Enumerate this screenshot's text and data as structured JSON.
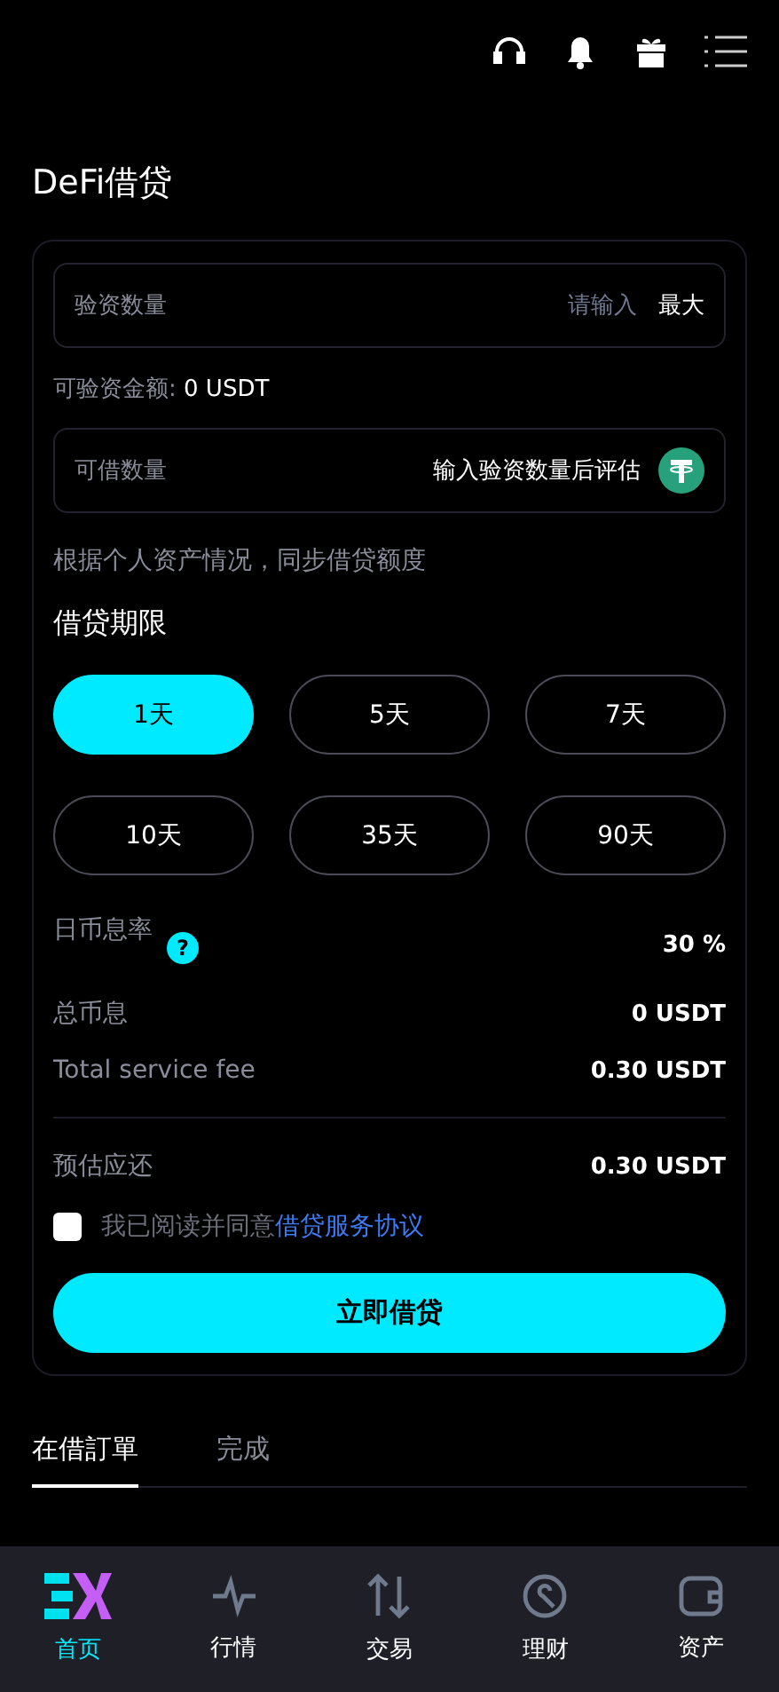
{
  "title": "DeFi借贷",
  "collateral_field": {
    "label": "验资数量",
    "placeholder": "请输入",
    "max_button": "最大"
  },
  "available": {
    "label": "可验资金额:",
    "value": "0 USDT"
  },
  "borrow_field": {
    "label": "可借数量",
    "value": "输入验资数量后评估"
  },
  "note": "根据个人资产情况，同步借贷额度",
  "term_heading": "借贷期限",
  "terms": [
    {
      "label": "1天",
      "selected": true
    },
    {
      "label": "5天",
      "selected": false
    },
    {
      "label": "7天",
      "selected": false
    },
    {
      "label": "10天",
      "selected": false
    },
    {
      "label": "35天",
      "selected": false
    },
    {
      "label": "90天",
      "selected": false
    }
  ],
  "rate": {
    "label": "日币息率",
    "help": "?",
    "value": "30 %"
  },
  "summary": [
    {
      "label": "总币息",
      "value": "0 USDT"
    },
    {
      "label": "Total service fee",
      "value": "0.30 USDT"
    }
  ],
  "repay": {
    "label": "预估应还",
    "value": "0.30 USDT"
  },
  "agreement": {
    "checked": false,
    "text": "我已阅读并同意",
    "link": "借贷服务协议"
  },
  "submit": "立即借贷",
  "order_tabs": [
    {
      "label": "在借訂單",
      "selected": true
    },
    {
      "label": "完成",
      "selected": false
    }
  ],
  "nav": [
    {
      "label": "首页",
      "selected": true
    },
    {
      "label": "行情",
      "selected": false
    },
    {
      "label": "交易",
      "selected": false
    },
    {
      "label": "理财",
      "selected": false
    },
    {
      "label": "资产",
      "selected": false
    }
  ]
}
